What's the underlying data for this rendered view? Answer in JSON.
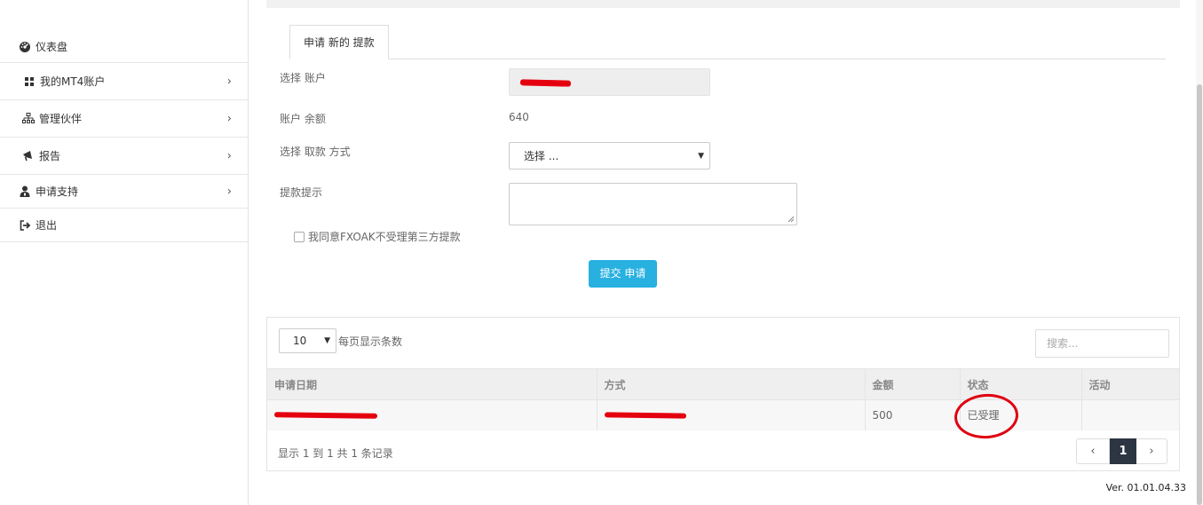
{
  "sidebar": {
    "items": [
      {
        "label": "仪表盘",
        "icon": "dashboard-icon"
      },
      {
        "label": "我的MT4账户",
        "icon": "grid-icon"
      },
      {
        "label": "管理伙伴",
        "icon": "sitemap-icon"
      },
      {
        "label": "报告",
        "icon": "bullhorn-icon"
      },
      {
        "label": "申请支持",
        "icon": "user-support-icon"
      },
      {
        "label": "退出",
        "icon": "sign-out-icon"
      }
    ]
  },
  "form": {
    "tab_label": "申请 新的 提款",
    "account_label": "选择 账户",
    "balance_label": "账户 余额",
    "balance_value": "640",
    "method_label": "选择 取款 方式",
    "method_value": "选择 ...",
    "note_label": "提款提示",
    "agree_label": "我同意FXOAK不受理第三方提款",
    "submit_label": "提交 申请"
  },
  "table": {
    "page_size": "10",
    "page_size_label": "每页显示条数",
    "search_placeholder": "搜索...",
    "columns": [
      "申请日期",
      "方式",
      "金额",
      "状态",
      "活动"
    ],
    "rows": [
      {
        "amount": "500",
        "status": "已受理"
      }
    ],
    "info": "显示 1 到 1 共 1 条记录",
    "pager": {
      "prev": "‹",
      "current": "1",
      "next": "›"
    }
  },
  "version": "Ver. 01.01.04.33",
  "colors": {
    "accent": "#27b0e0",
    "pager_active": "#2c3542",
    "redaction": "#e4000f"
  }
}
